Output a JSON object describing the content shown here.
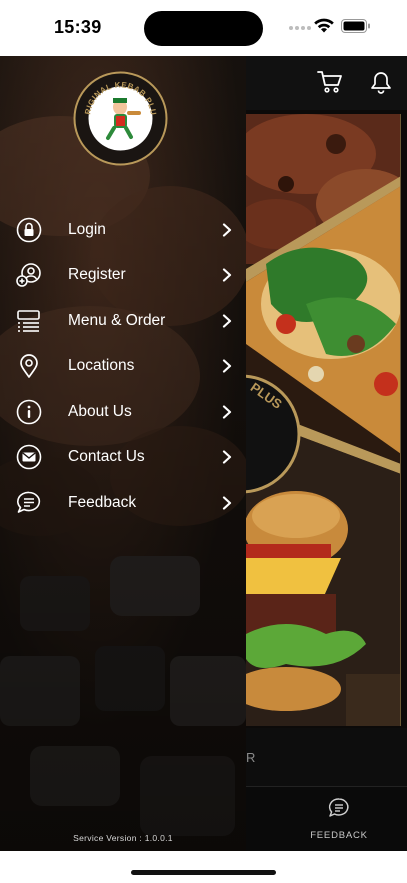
{
  "status_bar": {
    "time": "15:39"
  },
  "drawer": {
    "logo_text": "ORIGINAL KEBAB PLUS",
    "menu": [
      {
        "label": "Login",
        "icon": "lock-icon"
      },
      {
        "label": "Register",
        "icon": "add-user-icon"
      },
      {
        "label": "Menu & Order",
        "icon": "menu-list-icon"
      },
      {
        "label": "Locations",
        "icon": "location-pin-icon"
      },
      {
        "label": "About Us",
        "icon": "info-icon"
      },
      {
        "label": "Contact Us",
        "icon": "mail-icon"
      },
      {
        "label": "Feedback",
        "icon": "chat-icon"
      }
    ],
    "service_version": "Service Version : 1.0.0.1"
  },
  "background_app": {
    "banner_partial_text": "PLUS",
    "strip_partial_text": "R",
    "tab_feedback_label": "FEEDBACK"
  },
  "colors": {
    "accent_gold": "#b9995a",
    "drawer_text": "#ffffff"
  }
}
